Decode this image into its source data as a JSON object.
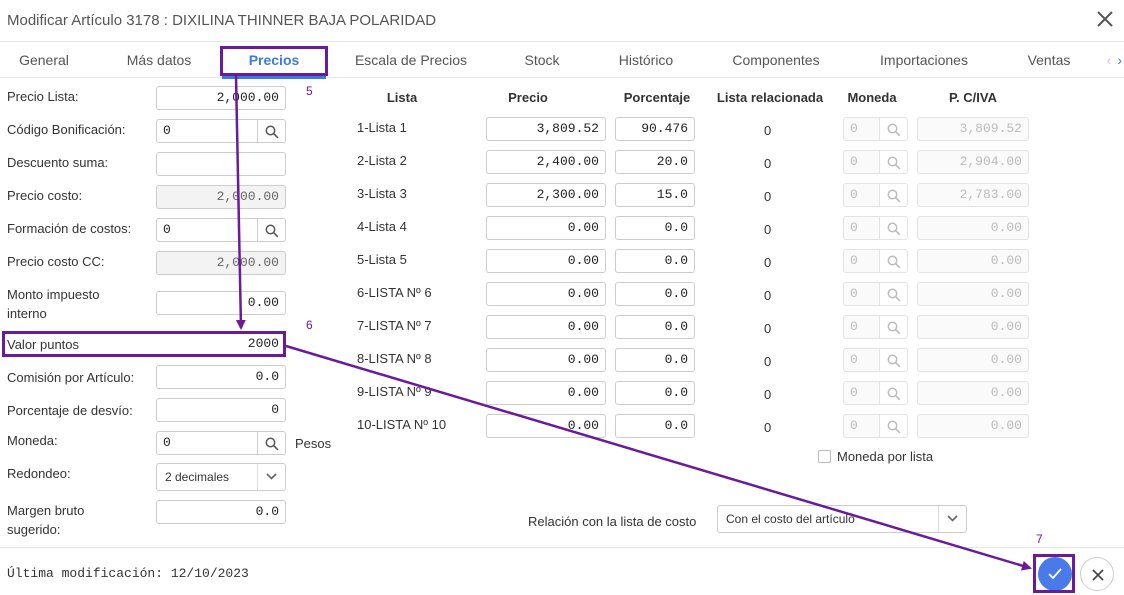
{
  "window": {
    "title": "Modificar Artículo 3178 : DIXILINA THINNER BAJA POLARIDAD"
  },
  "tabs": [
    "General",
    "Más datos",
    "Precios",
    "Escala de Precios",
    "Stock",
    "Histórico",
    "Componentes",
    "Importaciones",
    "Ventas"
  ],
  "active_tab": "Precios",
  "form": {
    "precio_lista": {
      "label": "Precio Lista:",
      "value": "2,000.00"
    },
    "codigo_bonificacion": {
      "label": "Código Bonificación:",
      "value": "0"
    },
    "descuento_suma": {
      "label": "Descuento suma:",
      "value": ""
    },
    "precio_costo": {
      "label": "Precio costo:",
      "value": "2,000.00"
    },
    "formacion_costos": {
      "label": "Formación de costos:",
      "value": "0"
    },
    "precio_costo_cc": {
      "label": "Precio costo CC:",
      "value": "2,000.00"
    },
    "monto_impuesto_interno": {
      "label_line1": "Monto impuesto",
      "label_line2": "interno",
      "value": "0.00"
    },
    "valor_puntos": {
      "label": "Valor puntos",
      "value": "2000"
    },
    "comision_articulo": {
      "label": "Comisión por Artículo:",
      "value": "0.0"
    },
    "porcentaje_desvio": {
      "label": "Porcentaje de desvío:",
      "value": "0"
    },
    "moneda": {
      "label": "Moneda:",
      "value": "0",
      "name": "Pesos"
    },
    "redondeo": {
      "label": "Redondeo:",
      "value": "2 decimales"
    },
    "margen_bruto": {
      "label_line1": "Margen bruto",
      "label_line2": "sugerido:",
      "value": "0.0"
    }
  },
  "price_table": {
    "headers": {
      "lista": "Lista",
      "precio": "Precio",
      "porcentaje": "Porcentaje",
      "lista_relacionada": "Lista relacionada",
      "moneda": "Moneda",
      "pciva": "P. C/IVA"
    },
    "rows": [
      {
        "lista": "1-Lista 1",
        "precio": "3,809.52",
        "porcentaje": "90.476",
        "relacionada": "0",
        "moneda": "0",
        "pciva": "3,809.52"
      },
      {
        "lista": "2-Lista 2",
        "precio": "2,400.00",
        "porcentaje": "20.0",
        "relacionada": "0",
        "moneda": "0",
        "pciva": "2,904.00"
      },
      {
        "lista": "3-Lista 3",
        "precio": "2,300.00",
        "porcentaje": "15.0",
        "relacionada": "0",
        "moneda": "0",
        "pciva": "2,783.00"
      },
      {
        "lista": "4-Lista 4",
        "precio": "0.00",
        "porcentaje": "0.0",
        "relacionada": "0",
        "moneda": "0",
        "pciva": "0.00"
      },
      {
        "lista": "5-Lista 5",
        "precio": "0.00",
        "porcentaje": "0.0",
        "relacionada": "0",
        "moneda": "0",
        "pciva": "0.00"
      },
      {
        "lista": "6-LISTA Nº 6",
        "precio": "0.00",
        "porcentaje": "0.0",
        "relacionada": "0",
        "moneda": "0",
        "pciva": "0.00"
      },
      {
        "lista": "7-LISTA Nº 7",
        "precio": "0.00",
        "porcentaje": "0.0",
        "relacionada": "0",
        "moneda": "0",
        "pciva": "0.00"
      },
      {
        "lista": "8-LISTA Nº 8",
        "precio": "0.00",
        "porcentaje": "0.0",
        "relacionada": "0",
        "moneda": "0",
        "pciva": "0.00"
      },
      {
        "lista": "9-LISTA Nº 9",
        "precio": "0.00",
        "porcentaje": "0.0",
        "relacionada": "0",
        "moneda": "0",
        "pciva": "0.00"
      },
      {
        "lista": "10-LISTA Nº 10",
        "precio": "0.00",
        "porcentaje": "0.0",
        "relacionada": "0",
        "moneda": "0",
        "pciva": "0.00"
      }
    ]
  },
  "moneda_por_lista": {
    "label": "Moneda por lista",
    "checked": false
  },
  "relacion_costo": {
    "label": "Relación con la lista de costo",
    "value": "Con el costo del artículo"
  },
  "footer": {
    "last_modified": "Última modificación: 12/10/2023"
  },
  "annotations": {
    "step5": "5",
    "step6": "6",
    "step7": "7",
    "color": "#6a1b9a"
  },
  "colors": {
    "accent": "#3a7be0",
    "confirm": "#4a7ae8"
  }
}
